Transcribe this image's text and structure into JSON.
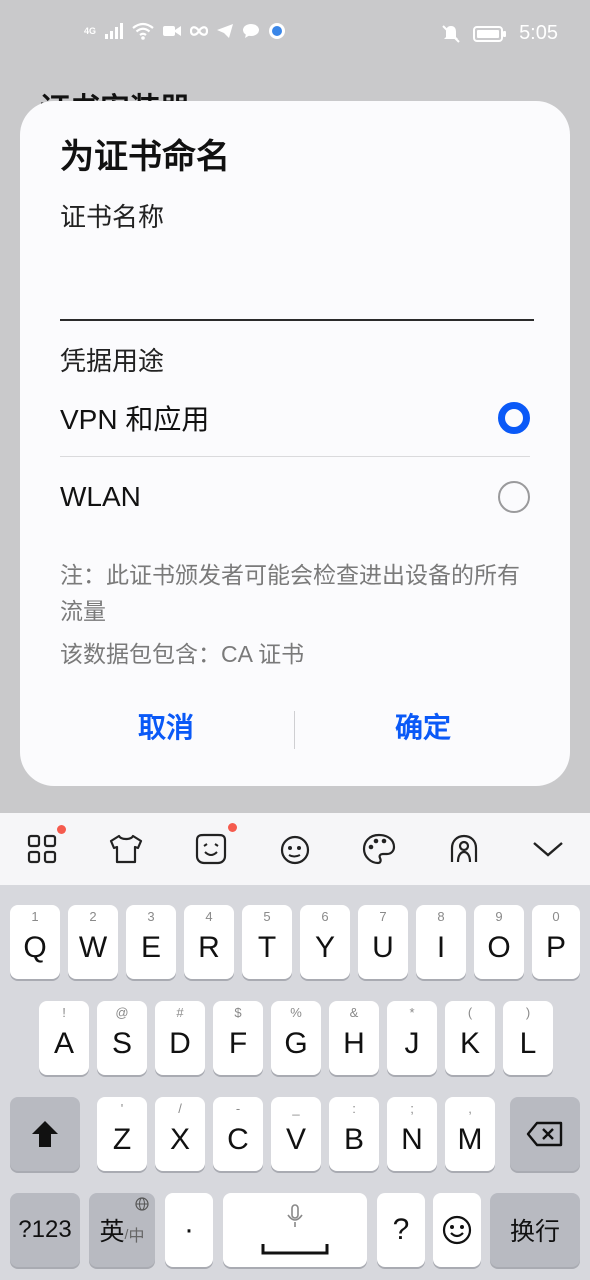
{
  "status": {
    "time": "5:05",
    "network": "4G"
  },
  "background": {
    "title": "证书安装器"
  },
  "dialog": {
    "title": "为证书命名",
    "name_label": "证书名称",
    "name_value": "",
    "usage_label": "凭据用途",
    "options": [
      {
        "label": "VPN 和应用",
        "selected": true
      },
      {
        "label": "WLAN",
        "selected": false
      }
    ],
    "note": "注：此证书颁发者可能会检查进出设备的所有流量",
    "contains": "该数据包包含：CA 证书",
    "cancel": "取消",
    "ok": "确定"
  },
  "keyboard": {
    "toolbar_icons": [
      "grid-icon",
      "shirt-icon",
      "emoji-icon",
      "sticker-icon",
      "palette-icon",
      "swipe-icon",
      "collapse-icon"
    ],
    "row1": [
      {
        "sub": "1",
        "key": "Q"
      },
      {
        "sub": "2",
        "key": "W"
      },
      {
        "sub": "3",
        "key": "E"
      },
      {
        "sub": "4",
        "key": "R"
      },
      {
        "sub": "5",
        "key": "T"
      },
      {
        "sub": "6",
        "key": "Y"
      },
      {
        "sub": "7",
        "key": "U"
      },
      {
        "sub": "8",
        "key": "I"
      },
      {
        "sub": "9",
        "key": "O"
      },
      {
        "sub": "0",
        "key": "P"
      }
    ],
    "row2": [
      {
        "sub": "!",
        "key": "A"
      },
      {
        "sub": "@",
        "key": "S"
      },
      {
        "sub": "#",
        "key": "D"
      },
      {
        "sub": "$",
        "key": "F"
      },
      {
        "sub": "%",
        "key": "G"
      },
      {
        "sub": "&",
        "key": "H"
      },
      {
        "sub": "*",
        "key": "J"
      },
      {
        "sub": "(",
        "key": "K"
      },
      {
        "sub": ")",
        "key": "L"
      }
    ],
    "row3": [
      {
        "sub": "'",
        "key": "Z"
      },
      {
        "sub": "/",
        "key": "X"
      },
      {
        "sub": "-",
        "key": "C"
      },
      {
        "sub": "_",
        "key": "V"
      },
      {
        "sub": ":",
        "key": "B"
      },
      {
        "sub": ";",
        "key": "N"
      },
      {
        "sub": ",",
        "key": "M"
      }
    ],
    "num_key": "?123",
    "lang_key": "英",
    "lang_sub": "中",
    "dot_key": "·",
    "question_key": "?",
    "enter_key": "换行"
  }
}
